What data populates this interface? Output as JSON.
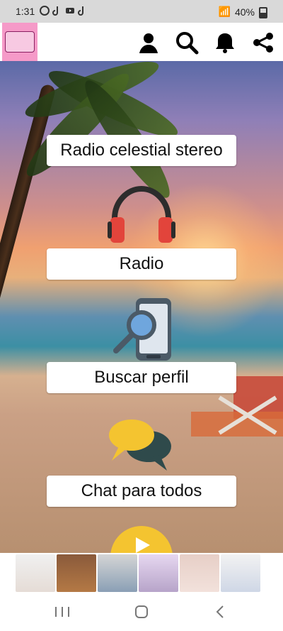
{
  "status_bar": {
    "time": "1:31",
    "battery_text": "40%"
  },
  "app": {
    "top_icons": [
      "user-icon",
      "search-icon",
      "bell-icon",
      "share-icon"
    ],
    "menu": {
      "radio_celestial_label": "Radio celestial stereo",
      "radio_label": "Radio",
      "buscar_label": "Buscar perfil",
      "chat_label": "Chat para todos"
    }
  },
  "colors": {
    "button_bg": "#ffffff",
    "headphone_red": "#e2443b",
    "phone_blue": "#6fa6dd",
    "chat_yellow": "#f4c430",
    "chat_dark": "#2f4a4b"
  }
}
